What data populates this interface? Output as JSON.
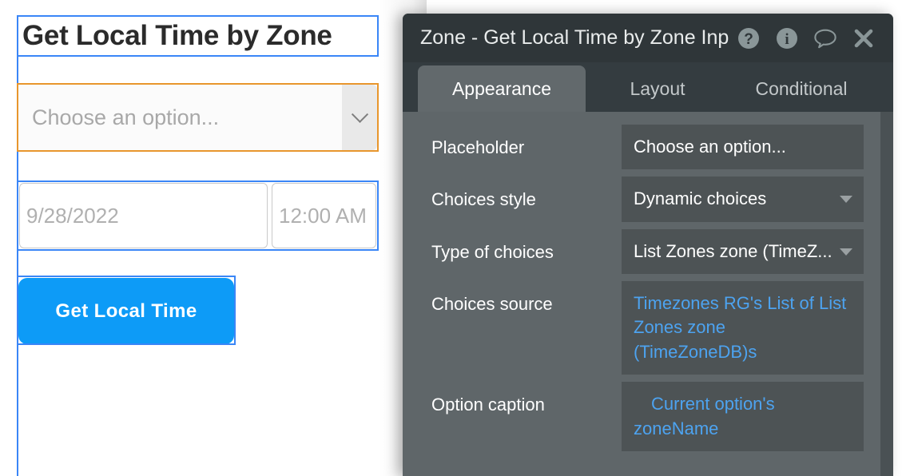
{
  "canvas": {
    "title_element": {
      "text": "Get Local Time by Zone"
    },
    "dropdown_element": {
      "placeholder": "Choose an option...",
      "arrow_icon": "chevron-down-icon"
    },
    "date_element": {
      "value": "9/28/2022"
    },
    "time_element": {
      "value": "12:00 AM"
    },
    "button_element": {
      "label": "Get Local Time",
      "color": "#0d9bf7"
    }
  },
  "editor": {
    "header": {
      "title": "Zone - Get Local Time by Zone Inp",
      "icons": [
        {
          "name": "help-icon",
          "glyph": "?"
        },
        {
          "name": "info-icon",
          "glyph": "i"
        },
        {
          "name": "comment-icon",
          "glyph": "speech-bubble"
        },
        {
          "name": "close-icon",
          "glyph": "x"
        }
      ]
    },
    "tabs": [
      {
        "label": "Appearance",
        "active": true
      },
      {
        "label": "Layout",
        "active": false
      },
      {
        "label": "Conditional",
        "active": false
      }
    ],
    "properties": [
      {
        "label": "Placeholder",
        "value": "Choose an option...",
        "type": "text",
        "link": false,
        "caret": false
      },
      {
        "label": "Choices style",
        "value": "Dynamic choices",
        "type": "dropdown",
        "link": false,
        "caret": true
      },
      {
        "label": "Type of choices",
        "value": "List Zones zone (TimeZoneDB)",
        "display": "List Zones zone (TimeZ...",
        "type": "dropdown",
        "link": false,
        "caret": true
      },
      {
        "label": "Choices source",
        "value": "Timezones RG's List of List Zones zone (TimeZoneDB)s",
        "type": "expression",
        "link": true,
        "caret": false
      },
      {
        "label": "Option caption",
        "value": "Current option's zoneName",
        "type": "expression",
        "link": true,
        "caret": false,
        "indent": true
      }
    ],
    "colors": {
      "panel_bg": "#5f6669",
      "header_bg": "#2f3639",
      "tabbar_bg": "#343c40",
      "active_tab_bg": "#62696c",
      "field_bg": "#4d5355",
      "link_text": "#4da3f0",
      "scrollbar": "#4a5154"
    }
  }
}
